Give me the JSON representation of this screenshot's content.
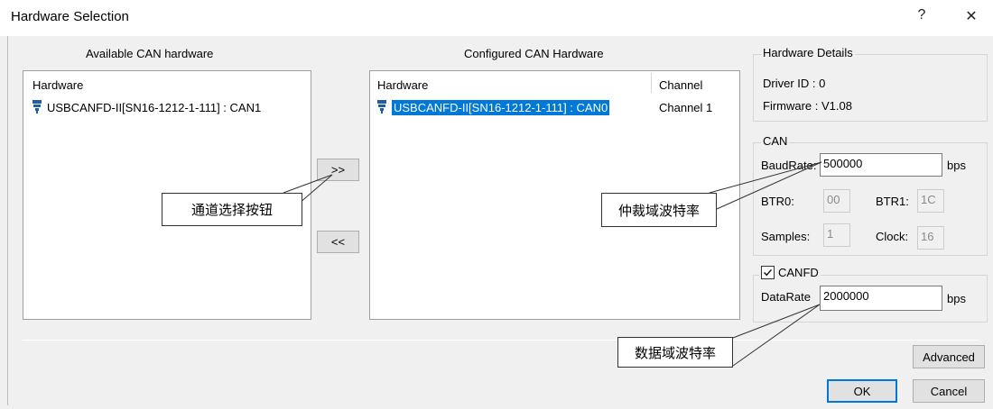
{
  "window": {
    "title": "Hardware Selection",
    "help_label": "?",
    "close_label": "✕"
  },
  "available": {
    "caption": "Available CAN hardware",
    "column_hardware": "Hardware",
    "items": [
      {
        "label": "USBCANFD-II[SN16-1212-1-111] : CAN1"
      }
    ]
  },
  "configured": {
    "caption": "Configured CAN Hardware",
    "column_hardware": "Hardware",
    "column_channel": "Channel",
    "items": [
      {
        "label": "USBCANFD-II[SN16-1212-1-111] : CAN0",
        "channel": "Channel 1"
      }
    ]
  },
  "transfer": {
    "add_label": ">>",
    "remove_label": "<<"
  },
  "details": {
    "legend": "Hardware Details",
    "driver_id": "Driver ID : 0",
    "firmware": "Firmware :  V1.08"
  },
  "can": {
    "legend": "CAN",
    "baudrate_label": "BaudRate:",
    "baudrate_value": "500000",
    "baudrate_unit": "bps",
    "btr0_label": "BTR0:",
    "btr0_value": "00",
    "btr1_label": "BTR1:",
    "btr1_value": "1C",
    "samples_label": "Samples:",
    "samples_value": "1",
    "clock_label": "Clock:",
    "clock_value": "16"
  },
  "canfd": {
    "checkbox_label": "CANFD",
    "checked": true,
    "datarate_label": "DataRate",
    "datarate_value": "2000000",
    "datarate_unit": "bps"
  },
  "annotations": {
    "channel_button": "通道选择按钮",
    "arbitration_baud": "仲裁域波特率",
    "data_baud": "数据域波特率"
  },
  "footer": {
    "advanced_label": "Advanced",
    "ok_label": "OK",
    "cancel_label": "Cancel"
  },
  "colors": {
    "selection": "#0078d7",
    "icon": "#1f5fa8"
  }
}
